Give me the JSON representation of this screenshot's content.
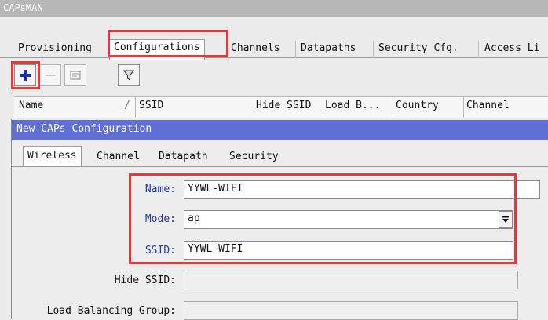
{
  "window": {
    "title": "CAPsMAN"
  },
  "tabs": [
    {
      "label": "Provisioning"
    },
    {
      "label": "Configurations"
    },
    {
      "label": "Channels"
    },
    {
      "label": "Datapaths"
    },
    {
      "label": "Security Cfg."
    },
    {
      "label": "Access Li"
    }
  ],
  "toolbar": {
    "add_icon": "plus-icon",
    "remove_icon": "minus-icon",
    "comment_icon": "note-icon",
    "filter_icon": "funnel-icon"
  },
  "list": {
    "columns": [
      "Name",
      "SSID",
      "Hide SSID",
      "Load B...",
      "Country",
      "Channel"
    ],
    "sort_indicator": "/"
  },
  "dialog": {
    "title": "New CAPs Configuration",
    "tabs": [
      "Wireless",
      "Channel",
      "Datapath",
      "Security"
    ],
    "fields": {
      "name": {
        "label": "Name:",
        "value": "YYWL-WIFI"
      },
      "mode": {
        "label": "Mode:",
        "value": "ap"
      },
      "ssid": {
        "label": "SSID:",
        "value": "YYWL-WIFI"
      },
      "hide_ssid": {
        "label": "Hide SSID:",
        "value": ""
      },
      "load_balancing_group": {
        "label": "Load Balancing Group:",
        "value": ""
      }
    }
  },
  "colors": {
    "accent": "#5f6fd6",
    "highlight": "#e03a3a",
    "field_label_blue": "#233bb0"
  }
}
